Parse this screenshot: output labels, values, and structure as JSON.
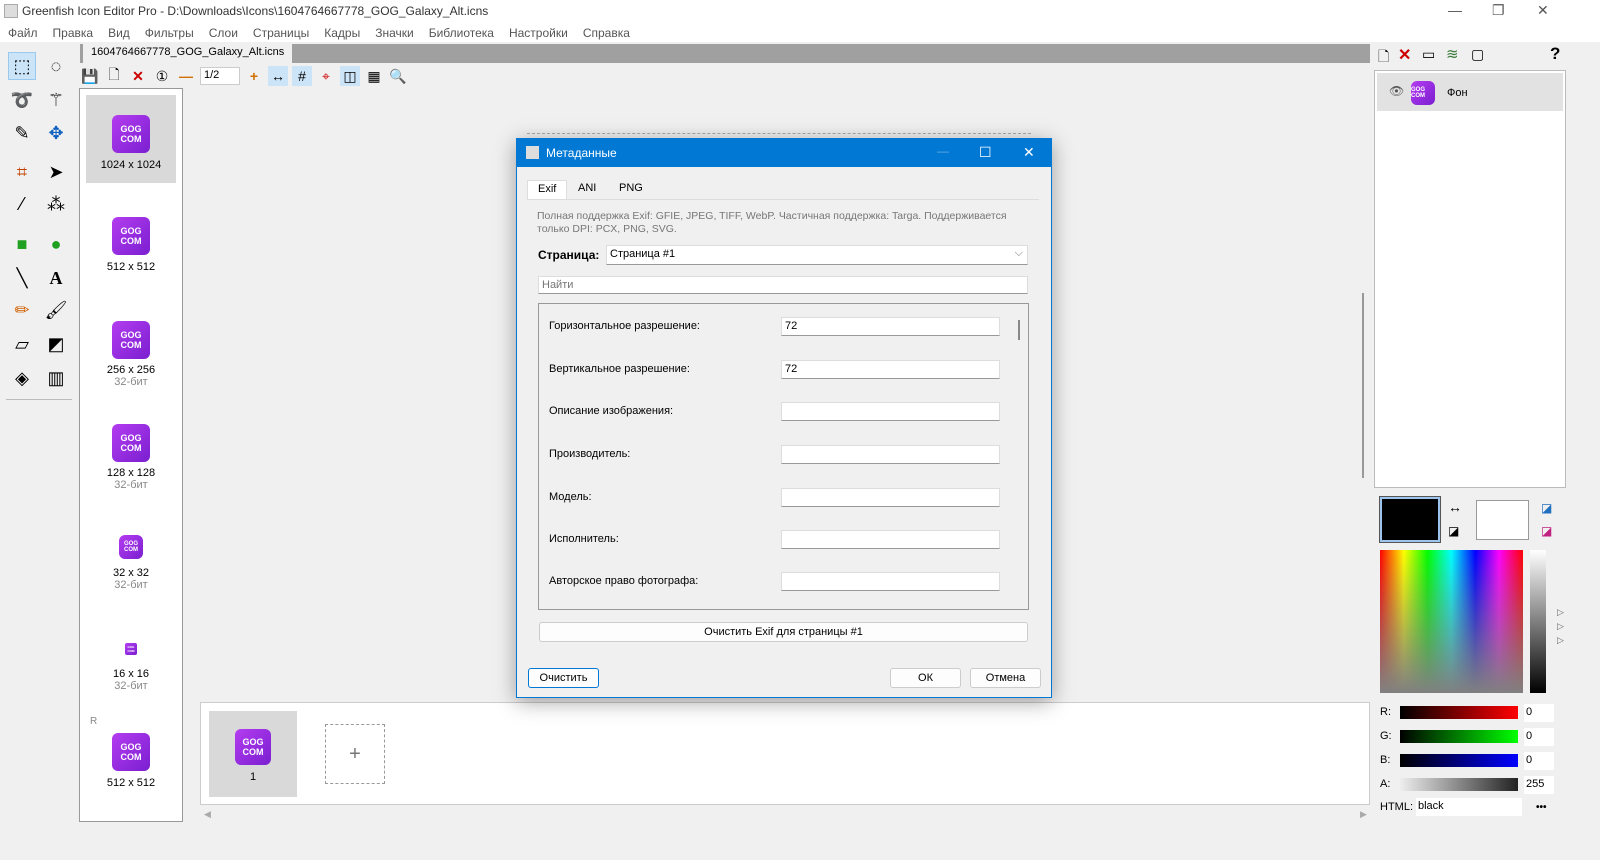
{
  "window": {
    "title": "Greenfish Icon Editor Pro - D:\\Downloads\\Icons\\1604764667778_GOG_Galaxy_Alt.icns",
    "min": "—",
    "max": "❐",
    "close": "✕"
  },
  "menu": [
    "Файл",
    "Правка",
    "Вид",
    "Фильтры",
    "Слои",
    "Страницы",
    "Кадры",
    "Значки",
    "Библиотека",
    "Настройки",
    "Справка"
  ],
  "doc_tab": "1604764667778_GOG_Galaxy_Alt.icns",
  "toolbar": {
    "page": "1/2"
  },
  "thumbnails": [
    {
      "size": "1024 x 1024",
      "sub": ""
    },
    {
      "size": "512 x 512",
      "sub": ""
    },
    {
      "size": "256 x 256",
      "sub": "32-бит"
    },
    {
      "size": "128 x 128",
      "sub": "32-бит"
    },
    {
      "size": "32 x 32",
      "sub": "32-бит"
    },
    {
      "size": "16 x 16",
      "sub": "32-бит"
    },
    {
      "size": "512 x 512",
      "sub": "",
      "marker": "R"
    }
  ],
  "icon_text": "GOG COM",
  "frames": [
    {
      "label": "1"
    }
  ],
  "add_frame": "+",
  "layers": [
    {
      "name": "Фон"
    }
  ],
  "dialog": {
    "title": "Метаданные",
    "tabs": [
      "Exif",
      "ANI",
      "PNG"
    ],
    "description": "Полная поддержка Exif: GFIE, JPEG, TIFF, WebP. Частичная поддержка: Targa. Поддерживается только DPI: PCX, PNG, SVG.",
    "page_label": "Страница:",
    "page_value": "Страница #1",
    "search_placeholder": "Найти",
    "fields": [
      {
        "label": "Горизонтальное разрешение:",
        "value": "72"
      },
      {
        "label": "Вертикальное разрешение:",
        "value": "72"
      },
      {
        "label": "Описание изображения:",
        "value": ""
      },
      {
        "label": "Производитель:",
        "value": ""
      },
      {
        "label": "Модель:",
        "value": ""
      },
      {
        "label": "Исполнитель:",
        "value": ""
      },
      {
        "label": "Авторское право фотографа:",
        "value": ""
      }
    ],
    "clear_page_button": "Очистить Exif для страницы #1",
    "clear_button": "Очистить",
    "ok_button": "ОК",
    "cancel_button": "Отмена"
  },
  "color": {
    "r": "0",
    "g": "0",
    "b": "0",
    "a": "255",
    "html": "black",
    "labels": {
      "r": "R:",
      "g": "G:",
      "b": "B:",
      "a": "A:",
      "html": "HTML:"
    },
    "more": "•••",
    "primary": "#000000",
    "secondary": "#ffffff"
  },
  "help": "?"
}
